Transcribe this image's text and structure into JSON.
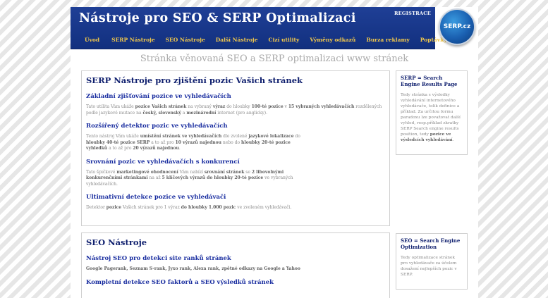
{
  "header": {
    "title": "Nástroje pro SEO & SERP Optimalizaci",
    "registrace": "REGISTRACE",
    "nav": [
      "Úvod",
      "SERP Nástroje",
      "SEO Nástroje",
      "Další Nástroje",
      "Cizí utility",
      "Výměny odkazů",
      "Burza reklamy",
      "Poptávky"
    ],
    "logo_text": "SERP.cz"
  },
  "tagline": "Stránka věnovaná SEO a SERP optimalizaci www stránek",
  "serp_panel": {
    "heading": "SERP Nástroje pro zjištění pozic Vašich stránek",
    "sections": [
      {
        "title": "Základní zjišťování pozice ve vyhledávačích",
        "parts": [
          {
            "t": "Tato utilita Vám ukáže "
          },
          {
            "b": "pozice Vašich stránek"
          },
          {
            "t": " na vybraný "
          },
          {
            "b": "výraz"
          },
          {
            "t": " do hloubky "
          },
          {
            "b": "100-té pozice"
          },
          {
            "t": " v "
          },
          {
            "b": "15 vybraných vyhledávačích"
          },
          {
            "t": " rozdělených podle jazykové mutace na "
          },
          {
            "b": "český, slovenský"
          },
          {
            "t": " a "
          },
          {
            "b": "mezinárodní"
          },
          {
            "t": " internet (pro anglicky)."
          }
        ]
      },
      {
        "title": "Rozšířený detektor pozic ve vyhledávačích",
        "parts": [
          {
            "t": "Tento nástroj Vám ukáže "
          },
          {
            "b": "umístění stránek ve vyhledávačích"
          },
          {
            "t": " dle zvolené "
          },
          {
            "b": "jazykové lokalizace"
          },
          {
            "t": " do "
          },
          {
            "b": "hloubky 40-té pozice SERP"
          },
          {
            "t": " a to až pro "
          },
          {
            "b": "10 výrazů najednou"
          },
          {
            "t": " nebo do "
          },
          {
            "b": "hloubky 20-té pozice vyhledků"
          },
          {
            "t": " a to až pro "
          },
          {
            "b": "20 výrazů najednou"
          },
          {
            "t": "."
          }
        ]
      },
      {
        "title": "Srovnání pozic ve vyhledávačích s konkurencí",
        "parts": [
          {
            "t": "Tato špičkové "
          },
          {
            "b": "marketingové ohodnocení"
          },
          {
            "t": " Vám nabízí "
          },
          {
            "b": "srovnání stránek"
          },
          {
            "t": " se "
          },
          {
            "b": "2 libovolnými konkurenčními stránkami"
          },
          {
            "t": " na až "
          },
          {
            "b": "5 klíčových výrazů do hloubky 20-té pozice"
          },
          {
            "t": " ve vybraných vyhledávačích."
          }
        ]
      },
      {
        "title": "Ultimativní detekce pozice ve vyhledávači",
        "parts": [
          {
            "t": "Detektor "
          },
          {
            "b": "pozice"
          },
          {
            "t": " Vašich stránek pro 1 výraz "
          },
          {
            "b": "do hloubky 1.000 pozic"
          },
          {
            "t": " ve zvoleném vyhledávači."
          }
        ]
      }
    ]
  },
  "seo_panel": {
    "heading": "SEO Nástroje",
    "sections": [
      {
        "title": "Nástroj SEO pro detekci site ranků stránek",
        "parts": [
          {
            "b": "Google Pagerank, Seznam S-rank, Jyxo rank, Alexa rank, zpětné odkazy na Google a Yahoo"
          }
        ]
      },
      {
        "title": "Kompletní detekce SEO faktorů a SEO výsledků stránek",
        "parts": []
      }
    ]
  },
  "sidebar": [
    {
      "heading": "SERP = Search Engine Results Page",
      "parts": [
        {
          "t": "Tedy stránka s výsledky vyhledávání internetového vyhledávače, tolik definice a příklad. Za určitou formu paradoxu lze považovat další vyhled, resp.příklad zkratky SERP Search engine results position, tedy "
        },
        {
          "b": "pozice ve výsledcích vyhledávání"
        },
        {
          "t": "."
        }
      ]
    },
    {
      "heading": "SEO = Search Engine Optimization",
      "parts": [
        {
          "t": "Tedy optimalizace stránek pro vyhledávače za účelem dosažení nejlepších pozic v SERP."
        }
      ]
    }
  ]
}
